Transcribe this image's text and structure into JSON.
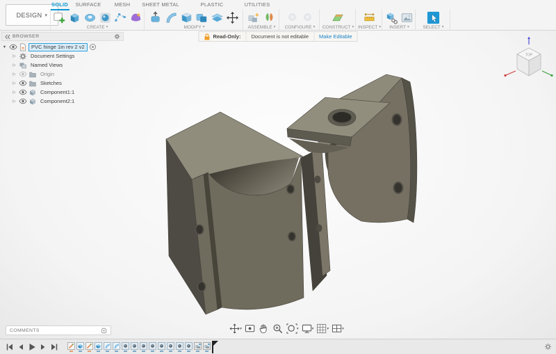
{
  "app": {
    "workspace": "DESIGN"
  },
  "ribbon": {
    "tabs": [
      {
        "label": "SOLID",
        "active": true
      },
      {
        "label": "SURFACE",
        "active": false
      },
      {
        "label": "MESH",
        "active": false
      },
      {
        "label": "SHEET METAL",
        "active": false
      },
      {
        "label": "PLASTIC",
        "active": false
      },
      {
        "label": "UTILITIES",
        "active": false
      }
    ],
    "groups": [
      {
        "label": "CREATE",
        "disabled": false,
        "icons": [
          "create-sketch",
          "extrude",
          "revolve",
          "sweep",
          "pipe",
          "create-form"
        ]
      },
      {
        "label": "MODIFY",
        "disabled": false,
        "icons": [
          "press-pull",
          "fillet",
          "shell",
          "combine",
          "split-body",
          "move-copy"
        ]
      },
      {
        "label": "ASSEMBLE",
        "disabled": false,
        "icons": [
          "new-component",
          "joint"
        ]
      },
      {
        "label": "CONFIGURE",
        "disabled": true,
        "icons": [
          "configure",
          "configuration-table"
        ]
      },
      {
        "label": "CONSTRUCT",
        "disabled": false,
        "icons": [
          "construction-plane"
        ]
      },
      {
        "label": "INSPECT",
        "disabled": false,
        "icons": [
          "measure"
        ]
      },
      {
        "label": "INSERT",
        "disabled": false,
        "icons": [
          "insert-derive",
          "insert-canvas"
        ]
      },
      {
        "label": "SELECT",
        "disabled": false,
        "icons": [
          "select"
        ]
      }
    ]
  },
  "banner": {
    "title": "Read-Only:",
    "message": "Document is not editable",
    "action": "Make Editable"
  },
  "browser": {
    "title": "BROWSER",
    "root": {
      "label": "PVC hinge 1in rev 2 v2",
      "selected": true
    },
    "items": [
      {
        "label": "Document Settings",
        "icon": "gear",
        "eye": false,
        "dimmed": false
      },
      {
        "label": "Named Views",
        "icon": "views",
        "eye": false,
        "dimmed": false
      },
      {
        "label": "Origin",
        "icon": "folder",
        "eye": true,
        "dimmed": true
      },
      {
        "label": "Sketches",
        "icon": "folder",
        "eye": true,
        "dimmed": false
      },
      {
        "label": "Component1:1",
        "icon": "component",
        "eye": true,
        "dimmed": false
      },
      {
        "label": "Component2:1",
        "icon": "component",
        "eye": true,
        "dimmed": false
      }
    ]
  },
  "viewcube": {
    "top": "TOP"
  },
  "comments": {
    "label": "COMMENTS"
  },
  "navbar": {
    "items": [
      {
        "name": "orbit",
        "dropdown": true
      },
      {
        "name": "look-at",
        "dropdown": false
      },
      {
        "name": "pan",
        "dropdown": false
      },
      {
        "name": "zoom",
        "dropdown": false
      },
      {
        "name": "fit",
        "dropdown": true
      },
      {
        "name": "display-settings",
        "dropdown": true
      },
      {
        "name": "grid-and-snaps",
        "dropdown": true
      },
      {
        "name": "viewports",
        "dropdown": true
      }
    ]
  },
  "timeline": {
    "playback": [
      "go-to-beginning",
      "step-back",
      "play",
      "step-forward",
      "go-to-end"
    ],
    "features": [
      "sketch",
      "extrude",
      "sketch",
      "extrude",
      "fillet",
      "fillet",
      "hole",
      "hole",
      "hole",
      "hole",
      "hole",
      "hole",
      "hole",
      "hole",
      "component",
      "component"
    ]
  },
  "model": {
    "name": "PVC hinge 1in rev 2 v2",
    "body_color": "#6f6b5d",
    "top_color": "#8f8c7c"
  }
}
